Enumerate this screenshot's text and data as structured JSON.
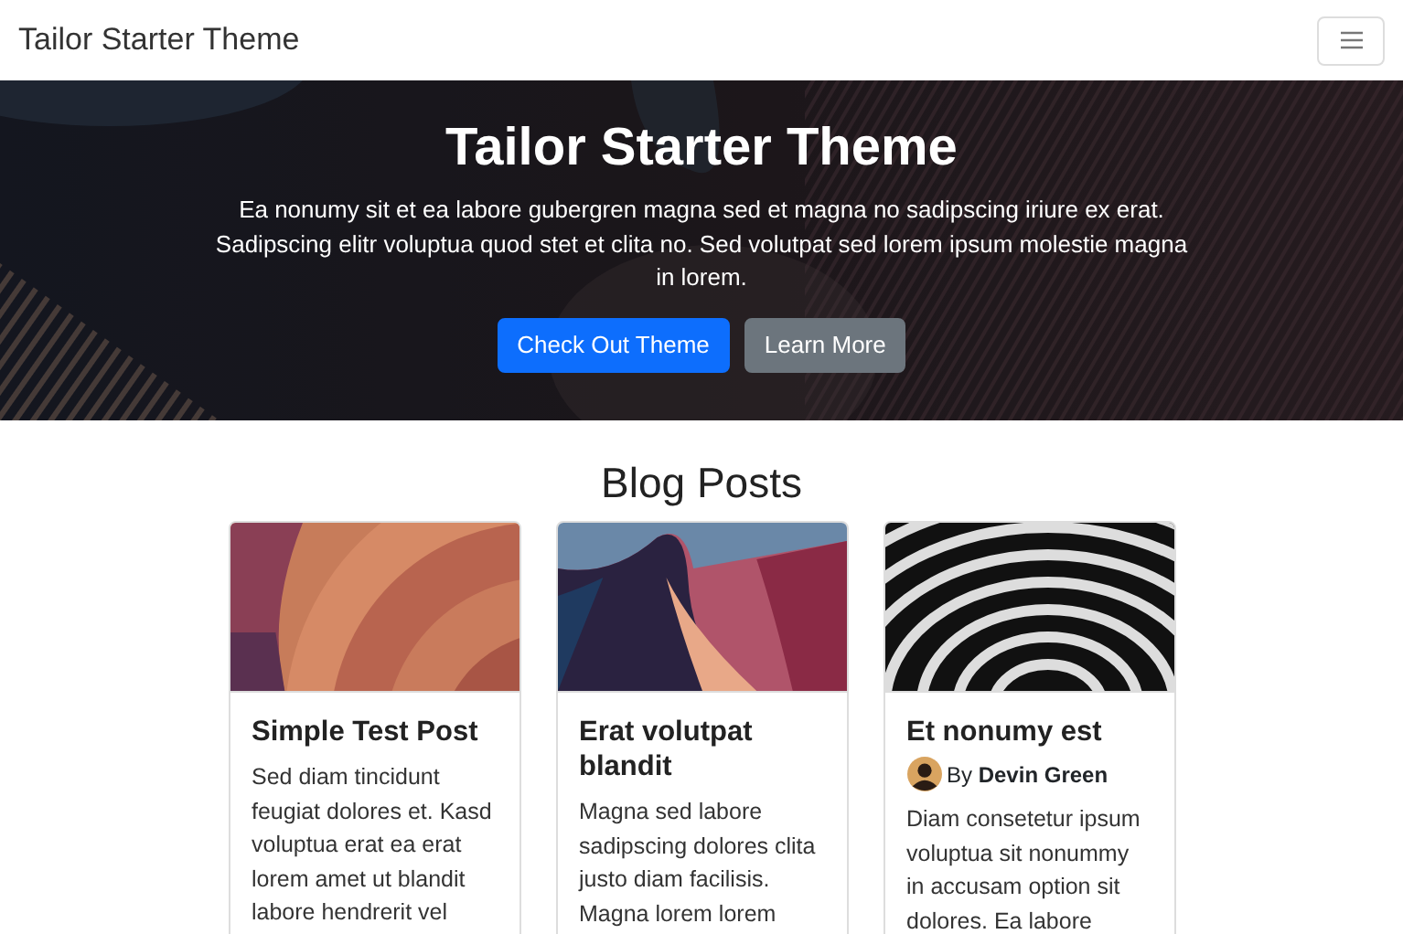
{
  "navbar": {
    "brand": "Tailor Starter Theme"
  },
  "hero": {
    "title": "Tailor Starter Theme",
    "text": "Ea nonumy sit et ea labore gubergren magna sed et magna no sadipscing iriure ex erat. Sadipscing elitr voluptua quod stet et clita no. Sed volutpat sed lorem ipsum molestie magna in lorem.",
    "buttons": [
      {
        "label": "Check Out Theme",
        "kind": "primary"
      },
      {
        "label": "Learn More",
        "kind": "secondary"
      }
    ]
  },
  "blog": {
    "title": "Blog Posts",
    "posts": [
      {
        "title": "Simple Test Post",
        "text": "Sed diam tincidunt feugiat dolores et. Kasd voluptua erat ea erat lorem amet ut blandit labore hendrerit vel"
      },
      {
        "title": "Erat volutpat blandit",
        "text": "Magna sed labore sadipscing dolores clita justo diam facilisis. Magna lorem lorem"
      },
      {
        "title": "Et nonumy est",
        "author": "By **Devin Green**",
        "text": "Diam consetetur ipsum voluptua sit nonummy in accusam option sit dolores. Ea labore"
      }
    ]
  }
}
